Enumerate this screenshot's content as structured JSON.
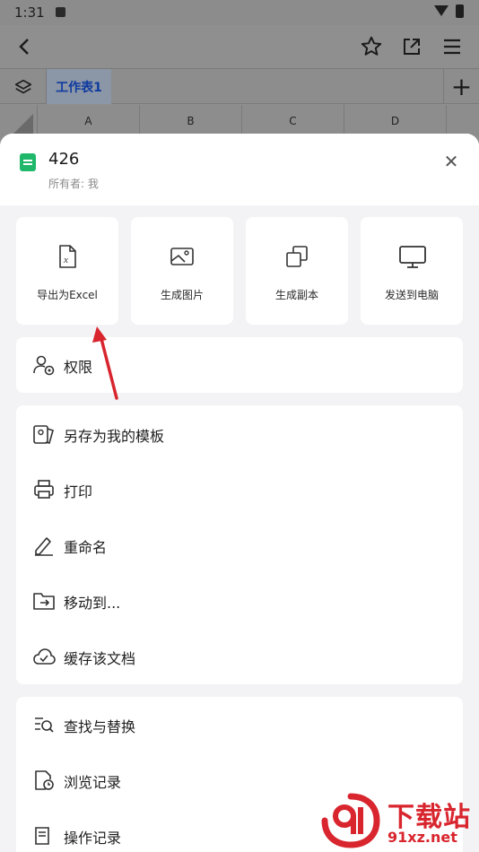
{
  "status_bar": {
    "time": "1:31"
  },
  "background": {
    "sheet_tab": "工作表1",
    "columns": [
      "A",
      "B",
      "C",
      "D"
    ]
  },
  "doc": {
    "title": "426",
    "owner": "所有者: 我"
  },
  "actions": [
    {
      "label": "导出为Excel",
      "icon": "excel-export-icon"
    },
    {
      "label": "生成图片",
      "icon": "image-icon"
    },
    {
      "label": "生成副本",
      "icon": "copy-icon"
    },
    {
      "label": "发送到电脑",
      "icon": "monitor-icon"
    }
  ],
  "permission": {
    "label": "权限",
    "icon": "user-permission-icon"
  },
  "menu_group_1": [
    {
      "label": "另存为我的模板",
      "icon": "template-icon"
    },
    {
      "label": "打印",
      "icon": "printer-icon"
    },
    {
      "label": "重命名",
      "icon": "pencil-icon"
    },
    {
      "label": "移动到...",
      "icon": "folder-move-icon"
    },
    {
      "label": "缓存该文档",
      "icon": "cloud-check-icon"
    }
  ],
  "menu_group_2": [
    {
      "label": "查找与替换",
      "icon": "find-replace-icon"
    },
    {
      "label": "浏览记录",
      "icon": "history-doc-icon"
    },
    {
      "label": "操作记录",
      "icon": "operation-log-icon"
    }
  ],
  "watermark": {
    "text": "下载站",
    "url": "91xz.net"
  },
  "colors": {
    "accent": "#1fb86a",
    "annotation": "#d8252e",
    "tab_text": "#0f3ba0"
  }
}
